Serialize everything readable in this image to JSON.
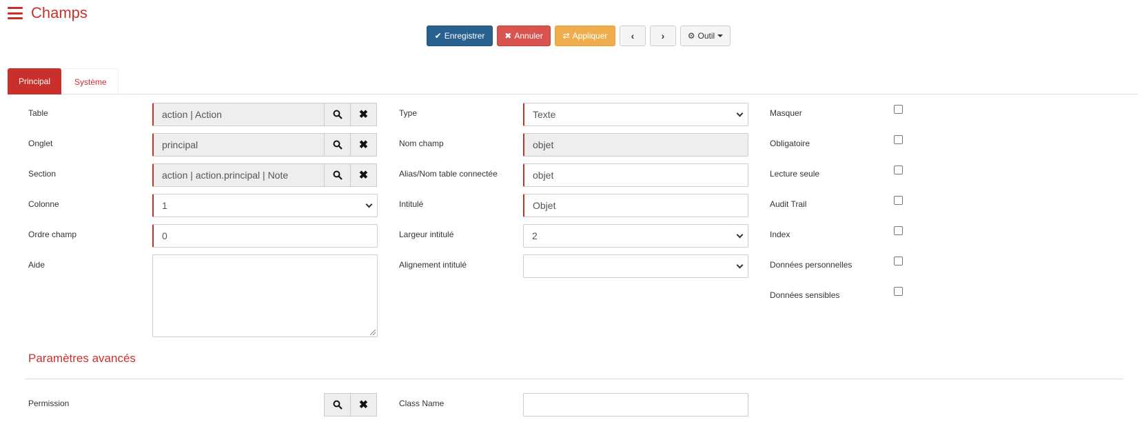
{
  "header": {
    "title": "Champs",
    "menu_icon": "hamburger-icon"
  },
  "toolbar": {
    "save_label": "Enregistrer",
    "cancel_label": "Annuler",
    "apply_label": "Appliquer",
    "prev_label": "‹",
    "next_label": "›",
    "tool_label": "Outil",
    "colors": {
      "primary": "#286090",
      "danger": "#d9534f",
      "warning": "#f0ad4e"
    }
  },
  "tabs": [
    {
      "label": "Principal",
      "active": true
    },
    {
      "label": "Système",
      "active": false
    }
  ],
  "left": {
    "table": {
      "label": "Table",
      "value": "action | Action"
    },
    "onglet": {
      "label": "Onglet",
      "value": "principal"
    },
    "section": {
      "label": "Section",
      "value": "action | action.principal | Note"
    },
    "colonne": {
      "label": "Colonne",
      "value": "1"
    },
    "ordre": {
      "label": "Ordre champ",
      "value": "0"
    },
    "aide": {
      "label": "Aide",
      "value": ""
    }
  },
  "middle": {
    "type": {
      "label": "Type",
      "value": "Texte"
    },
    "nom": {
      "label": "Nom champ",
      "value": "objet"
    },
    "alias": {
      "label": "Alias/Nom table connectée",
      "value": "objet"
    },
    "intitule": {
      "label": "Intitulé",
      "value": "Objet"
    },
    "largeur": {
      "label": "Largeur intitulé",
      "value": "2"
    },
    "alignement": {
      "label": "Alignement intitulé",
      "value": ""
    }
  },
  "right": {
    "masquer": {
      "label": "Masquer",
      "checked": false
    },
    "obligatoire": {
      "label": "Obligatoire",
      "checked": false
    },
    "lecture": {
      "label": "Lecture seule",
      "checked": false
    },
    "audit": {
      "label": "Audit Trail",
      "checked": false
    },
    "index": {
      "label": "Index",
      "checked": false
    },
    "perso": {
      "label": "Données personnelles",
      "checked": false
    },
    "sensibles": {
      "label": "Données sensibles",
      "checked": false
    }
  },
  "advanced": {
    "title": "Paramètres avancés",
    "permission": {
      "label": "Permission",
      "value": ""
    },
    "classname": {
      "label": "Class Name",
      "value": ""
    }
  },
  "accent_color": "#c9302c"
}
